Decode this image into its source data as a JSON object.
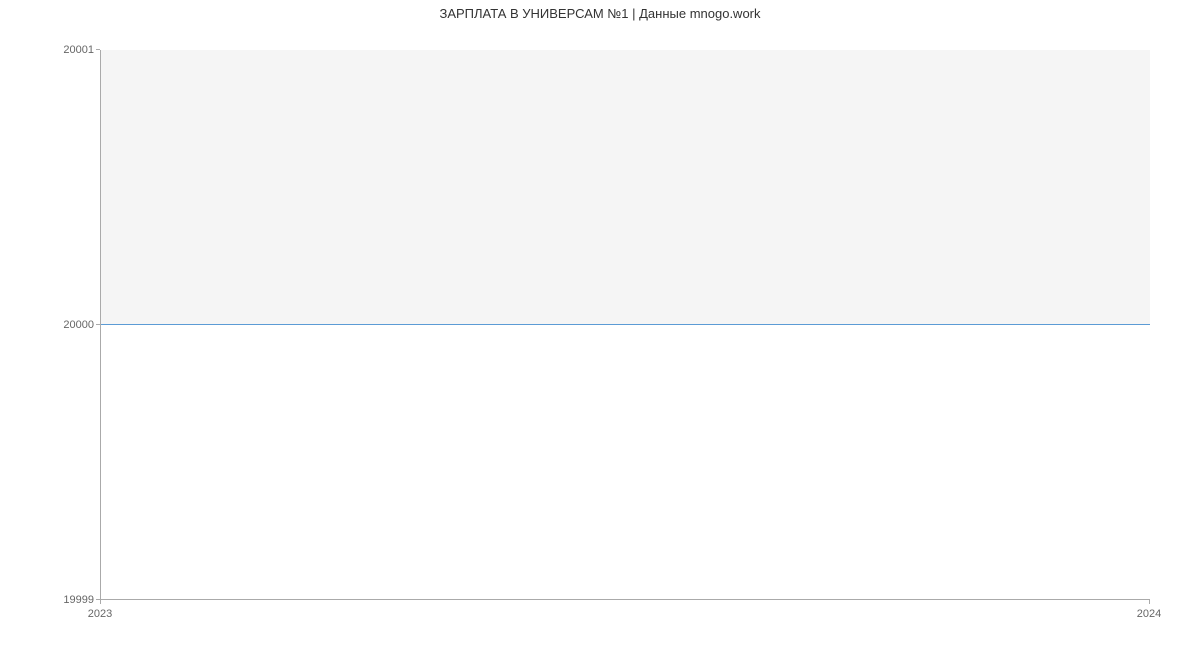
{
  "chart_data": {
    "type": "line",
    "title": "ЗАРПЛАТА В   УНИВЕРСАМ №1 | Данные mnogo.work",
    "xlabel": "",
    "ylabel": "",
    "x": [
      "2023",
      "2024"
    ],
    "values": [
      20000,
      20000
    ],
    "y_ticks": [
      "19999",
      "20000",
      "20001"
    ],
    "ylim": [
      19999,
      20001
    ],
    "xlim_labels": [
      "2023",
      "2024"
    ],
    "grid": false,
    "line_color": "#5b9bd5",
    "plot_bg": "#f5f5f5"
  }
}
